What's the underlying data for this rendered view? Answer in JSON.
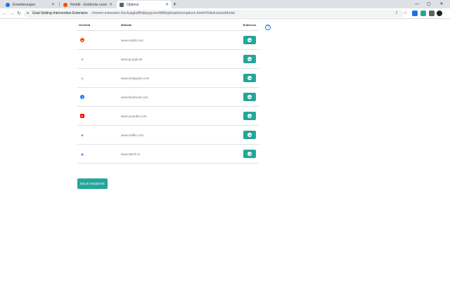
{
  "browser": {
    "tabs": [
      {
        "title": "Erweiterungen",
        "favicon_color": "#1a73e8"
      },
      {
        "title": "Reddit - Entdecke unendliche",
        "favicon_color": "#ff4500"
      },
      {
        "title": "Options",
        "favicon_color": "#5f6368"
      }
    ],
    "new_tab_label": "+",
    "omnibox": {
      "extension_name": "Goal-Setting-Intervention Extension",
      "url": "chrome-extension://iecfcjagkidfhdjicpgcoecfdfdfegk/options/options.html#!#/distractionModal"
    }
  },
  "table": {
    "headers": {
      "icon": "Overfeld",
      "website": "Website",
      "action": "Entfernen"
    },
    "rows": [
      {
        "icon": "reddit-icon",
        "icon_color": "#ff4500",
        "glyph": "●",
        "site": "www.reddit.com"
      },
      {
        "icon": "google-icon",
        "icon_color": "#4285f4",
        "glyph": "G",
        "site": "www.google.de"
      },
      {
        "icon": "instagram-icon",
        "icon_color": "#c13584",
        "glyph": "◎",
        "site": "www.instagram.com"
      },
      {
        "icon": "facebook-icon",
        "icon_color": "#1877f2",
        "glyph": "f",
        "site": "www.facebook.com"
      },
      {
        "icon": "youtube-icon",
        "icon_color": "#ff0000",
        "glyph": "▶",
        "site": "www.youtube.com"
      },
      {
        "icon": "netflix-icon",
        "icon_color": "#e50914",
        "glyph": "N",
        "site": "www.netflix.com"
      },
      {
        "icon": "twitch-icon",
        "icon_color": "#9146ff",
        "glyph": "▣",
        "site": "www.twitch.tv"
      }
    ]
  },
  "help_label": "?",
  "add_button_label": "NEUE WEBSITE",
  "accent_color": "#26a69a"
}
